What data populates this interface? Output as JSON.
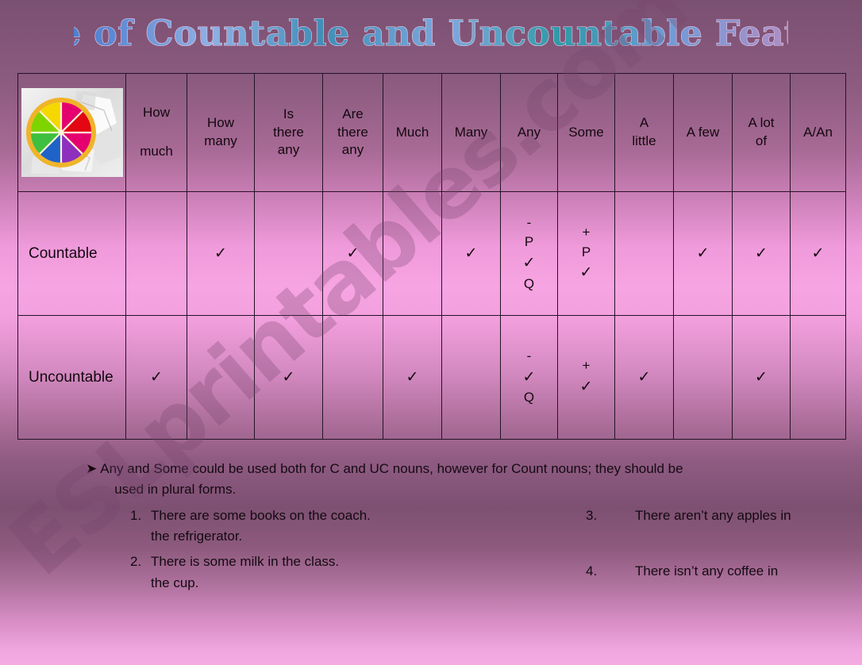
{
  "slide": {
    "title": "Table of Countable and Uncountable Features",
    "watermark": "ESLprintables.com",
    "colors": {
      "background_top": "#7d5376",
      "background_mid_pink": "#f4a4e0",
      "background_low_purple": "#7d5071",
      "background_bottom": "#f4abe2",
      "table_border": "#241426",
      "text": "#14080f",
      "title_fill_start": "#2fa3a8",
      "title_fill_mid": "#4f7fd0",
      "title_fill_end": "#d98fc6",
      "title_outline": "#f2cfe6",
      "watermark_color": "rgba(120,70,110,0.30)"
    }
  },
  "table": {
    "corner_image": {
      "alt": "rainbow orange slice on ice cubes",
      "icon": "citrus-ice-photo"
    },
    "columns": [
      {
        "key": "corner",
        "line1": "",
        "line2": ""
      },
      {
        "key": "how_much",
        "line1": "How",
        "line2": "much",
        "spaced": true
      },
      {
        "key": "how_many",
        "line1": "How",
        "line2": "many",
        "spaced": false
      },
      {
        "key": "is_there_any",
        "line1": "Is",
        "line2": "there",
        "line3": "any",
        "spaced": false
      },
      {
        "key": "are_there_any",
        "line1": "Are",
        "line2": "there",
        "line3": "any",
        "spaced": false
      },
      {
        "key": "much",
        "line1": "Much",
        "line2": "",
        "spaced": false
      },
      {
        "key": "many",
        "line1": "Many",
        "line2": "",
        "spaced": false
      },
      {
        "key": "any",
        "line1": "Any",
        "line2": "",
        "spaced": false
      },
      {
        "key": "some",
        "line1": "Some",
        "line2": "",
        "spaced": false
      },
      {
        "key": "a_little",
        "line1": "A",
        "line2": "little",
        "spaced": false
      },
      {
        "key": "a_few",
        "line1": "A few",
        "line2": "",
        "spaced": false
      },
      {
        "key": "a_lot_of",
        "line1": "A lot",
        "line2": "of",
        "spaced": false
      },
      {
        "key": "a_an",
        "line1": "A/An",
        "line2": "",
        "spaced": false
      }
    ],
    "rows": [
      {
        "label": "Countable",
        "cells": [
          {
            "key": "how_much",
            "tick": false
          },
          {
            "key": "how_many",
            "tick": true
          },
          {
            "key": "is_there_any",
            "tick": false
          },
          {
            "key": "are_there_any",
            "tick": true
          },
          {
            "key": "much",
            "tick": false
          },
          {
            "key": "many",
            "tick": true
          },
          {
            "key": "any",
            "tick": true,
            "sign": "-",
            "above": "P",
            "below": "Q"
          },
          {
            "key": "some",
            "tick": true,
            "sign": "+",
            "above": "P",
            "below": ""
          },
          {
            "key": "a_little",
            "tick": false
          },
          {
            "key": "a_few",
            "tick": true
          },
          {
            "key": "a_lot_of",
            "tick": true
          },
          {
            "key": "a_an",
            "tick": true
          }
        ]
      },
      {
        "label": "Uncountable",
        "cells": [
          {
            "key": "how_much",
            "tick": true
          },
          {
            "key": "how_many",
            "tick": false
          },
          {
            "key": "is_there_any",
            "tick": true
          },
          {
            "key": "are_there_any",
            "tick": false
          },
          {
            "key": "much",
            "tick": true
          },
          {
            "key": "many",
            "tick": false
          },
          {
            "key": "any",
            "tick": true,
            "sign": "-",
            "above": "",
            "below": "Q"
          },
          {
            "key": "some",
            "tick": true,
            "sign": "+",
            "above": "",
            "below": ""
          },
          {
            "key": "a_little",
            "tick": true
          },
          {
            "key": "a_few",
            "tick": false
          },
          {
            "key": "a_lot_of",
            "tick": true
          },
          {
            "key": "a_an",
            "tick": false
          }
        ]
      }
    ],
    "tick_glyph": "✓"
  },
  "notes": {
    "bullet_glyph": "➤",
    "bullet_line1": "Any and Some could be used both for C and UC nouns, however for Count nouns; they should be",
    "bullet_line2": "used in plural forms.",
    "examples_left": [
      {
        "num": "1.",
        "text": "There are some books on the coach.",
        "cont": ""
      },
      {
        "num": "2.",
        "text": "There is some milk in the class.",
        "cont": ""
      }
    ],
    "examples_right": [
      {
        "num": "3.",
        "text": "There aren’t any apples in",
        "cont": ""
      },
      {
        "num": "4.",
        "text": "There isn’t any coffee in",
        "cont": ""
      }
    ],
    "continuations_left": [
      {
        "text": "the refrigerator."
      },
      {
        "text": "the cup."
      }
    ]
  }
}
